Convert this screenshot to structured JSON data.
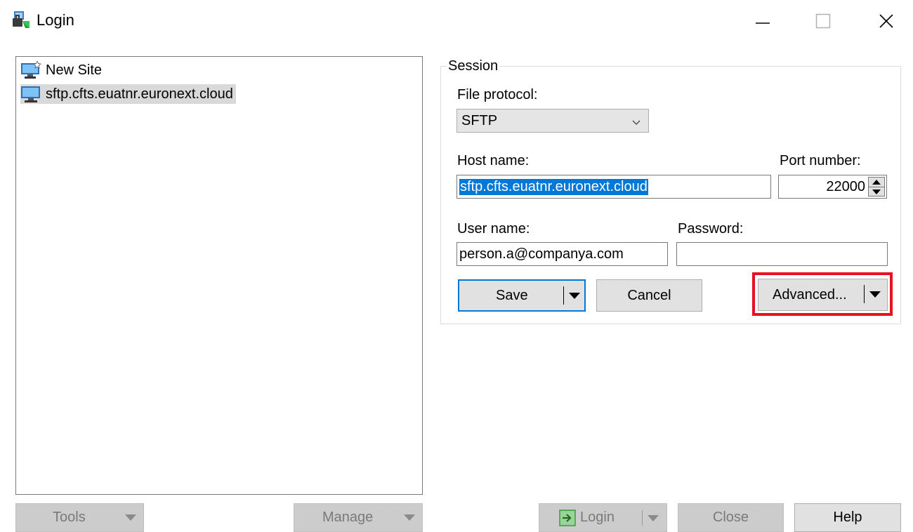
{
  "window": {
    "title": "Login",
    "icon": "winscp-login-icon",
    "controls": {
      "minimize": "—",
      "maximize": "☐",
      "close": "✕"
    }
  },
  "sites": [
    {
      "label": "New Site",
      "icon": "new-site-icon",
      "selected": false
    },
    {
      "label": "sftp.cfts.euatnr.euronext.cloud",
      "icon": "computer-icon",
      "selected": true
    }
  ],
  "session": {
    "legend": "Session",
    "file_protocol_label": "File protocol:",
    "file_protocol_value": "SFTP",
    "host_name_label": "Host name:",
    "host_name_value": "sftp.cfts.euatnr.euronext.cloud",
    "port_label": "Port number:",
    "port_value": "22000",
    "user_name_label": "User name:",
    "user_name_value": "person.a@companya.com",
    "password_label": "Password:",
    "password_value": "",
    "save_label": "Save",
    "cancel_label": "Cancel",
    "advanced_label": "Advanced..."
  },
  "footer": {
    "tools_label": "Tools",
    "manage_label": "Manage",
    "login_label": "Login",
    "close_label": "Close",
    "help_label": "Help"
  },
  "colors": {
    "highlight": "#e81123",
    "selection": "#0078d7",
    "button_face": "#e1e1e1",
    "disabled_face": "#cccccc"
  }
}
